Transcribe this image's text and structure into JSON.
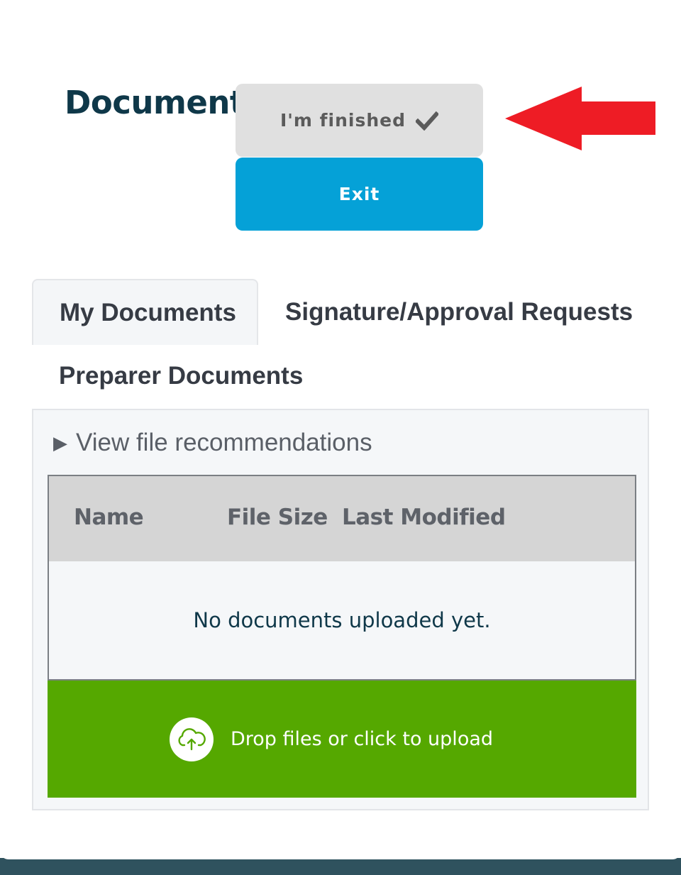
{
  "header": {
    "title": "Documents",
    "finished_label": "I'm finished",
    "exit_label": "Exit"
  },
  "tabs": [
    {
      "label": "My Documents",
      "active": true
    },
    {
      "label": "Signature/Approval Requests",
      "active": false
    },
    {
      "label": "Preparer Documents",
      "active": false
    }
  ],
  "panel": {
    "recommendations_label": "View file recommendations",
    "table": {
      "columns": [
        "Name",
        "File Size",
        "Last Modified"
      ],
      "empty_message": "No documents uploaded yet."
    },
    "upload_label": "Drop files or click to upload"
  },
  "colors": {
    "title": "#0f3849",
    "exit_button": "#05a1d7",
    "upload_area": "#55a800",
    "annotation_arrow": "#ee1c25",
    "bottom_bar": "#2f525e"
  },
  "icons": {
    "finished": "checkmark-icon",
    "recommendations": "triangle-right-icon",
    "upload": "cloud-upload-icon",
    "annotation": "red-arrow-left-icon"
  }
}
